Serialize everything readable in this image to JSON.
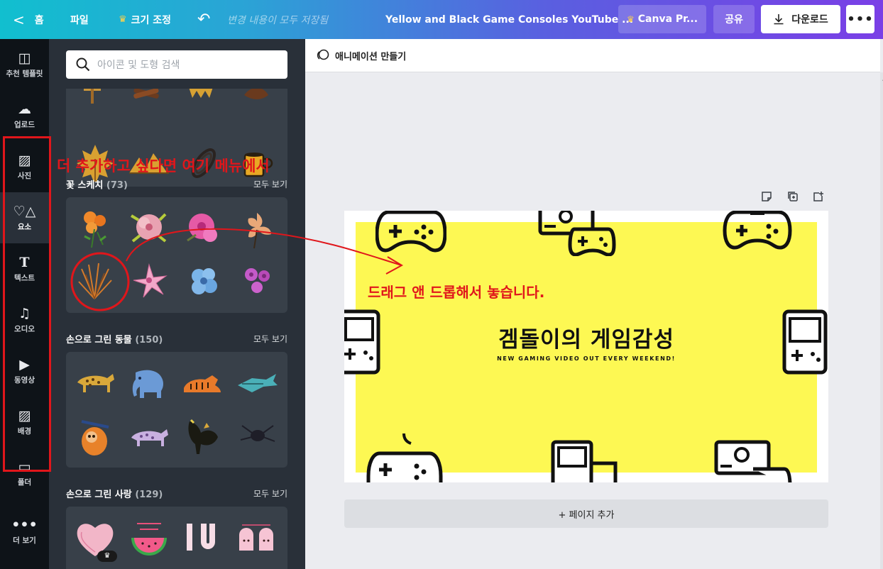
{
  "topbar": {
    "home_label": "홈",
    "file_label": "파일",
    "resize_label": "크기 조정",
    "saved_status": "변경 내용이 모두 저장됨",
    "doc_title": "Yellow and Black Game Consoles YouTube ...",
    "pro_label": "Canva Pr...",
    "share_label": "공유",
    "download_label": "다운로드",
    "more_label": "•••"
  },
  "rail": {
    "items": [
      {
        "label": "추천 템플릿",
        "icon": "template-icon"
      },
      {
        "label": "업로드",
        "icon": "upload-cloud-icon"
      },
      {
        "label": "사진",
        "icon": "photo-icon"
      },
      {
        "label": "요소",
        "icon": "elements-shapes-icon"
      },
      {
        "label": "텍스트",
        "icon": "text-icon"
      },
      {
        "label": "오디오",
        "icon": "music-note-icon"
      },
      {
        "label": "동영상",
        "icon": "video-icon"
      },
      {
        "label": "배경",
        "icon": "background-pattern-icon"
      },
      {
        "label": "폴더",
        "icon": "folder-icon"
      },
      {
        "label": "더 보기",
        "icon": "more-dots-icon"
      }
    ]
  },
  "panel": {
    "search_placeholder": "아이콘 및 도형 검색",
    "sections": [
      {
        "title": "꽃 스케치",
        "count": "(73)",
        "see_all": "모두 보기"
      },
      {
        "title": "손으로 그린 동물",
        "count": "(150)",
        "see_all": "모두 보기"
      },
      {
        "title": "손으로 그린 사랑",
        "count": "(129)",
        "see_all": "모두 보기"
      }
    ]
  },
  "stage": {
    "animate_label": "애니메이션 만들기",
    "add_page_label": "+ 페이지 추가",
    "design_title": "겜돌이의 게임감성",
    "design_subtitle": "NEW GAMING VIDEO OUT EVERY WEEKEND!"
  },
  "annotations": {
    "menu_note": "더 추가하고 싶다면 여기 메뉴에서",
    "drag_note": "드래그 앤 드롭해서 놓습니다."
  },
  "colors": {
    "annotation_red": "#e0161b",
    "design_yellow": "#fdf853",
    "panel_bg": "#293039",
    "rail_bg": "#0e1318"
  }
}
